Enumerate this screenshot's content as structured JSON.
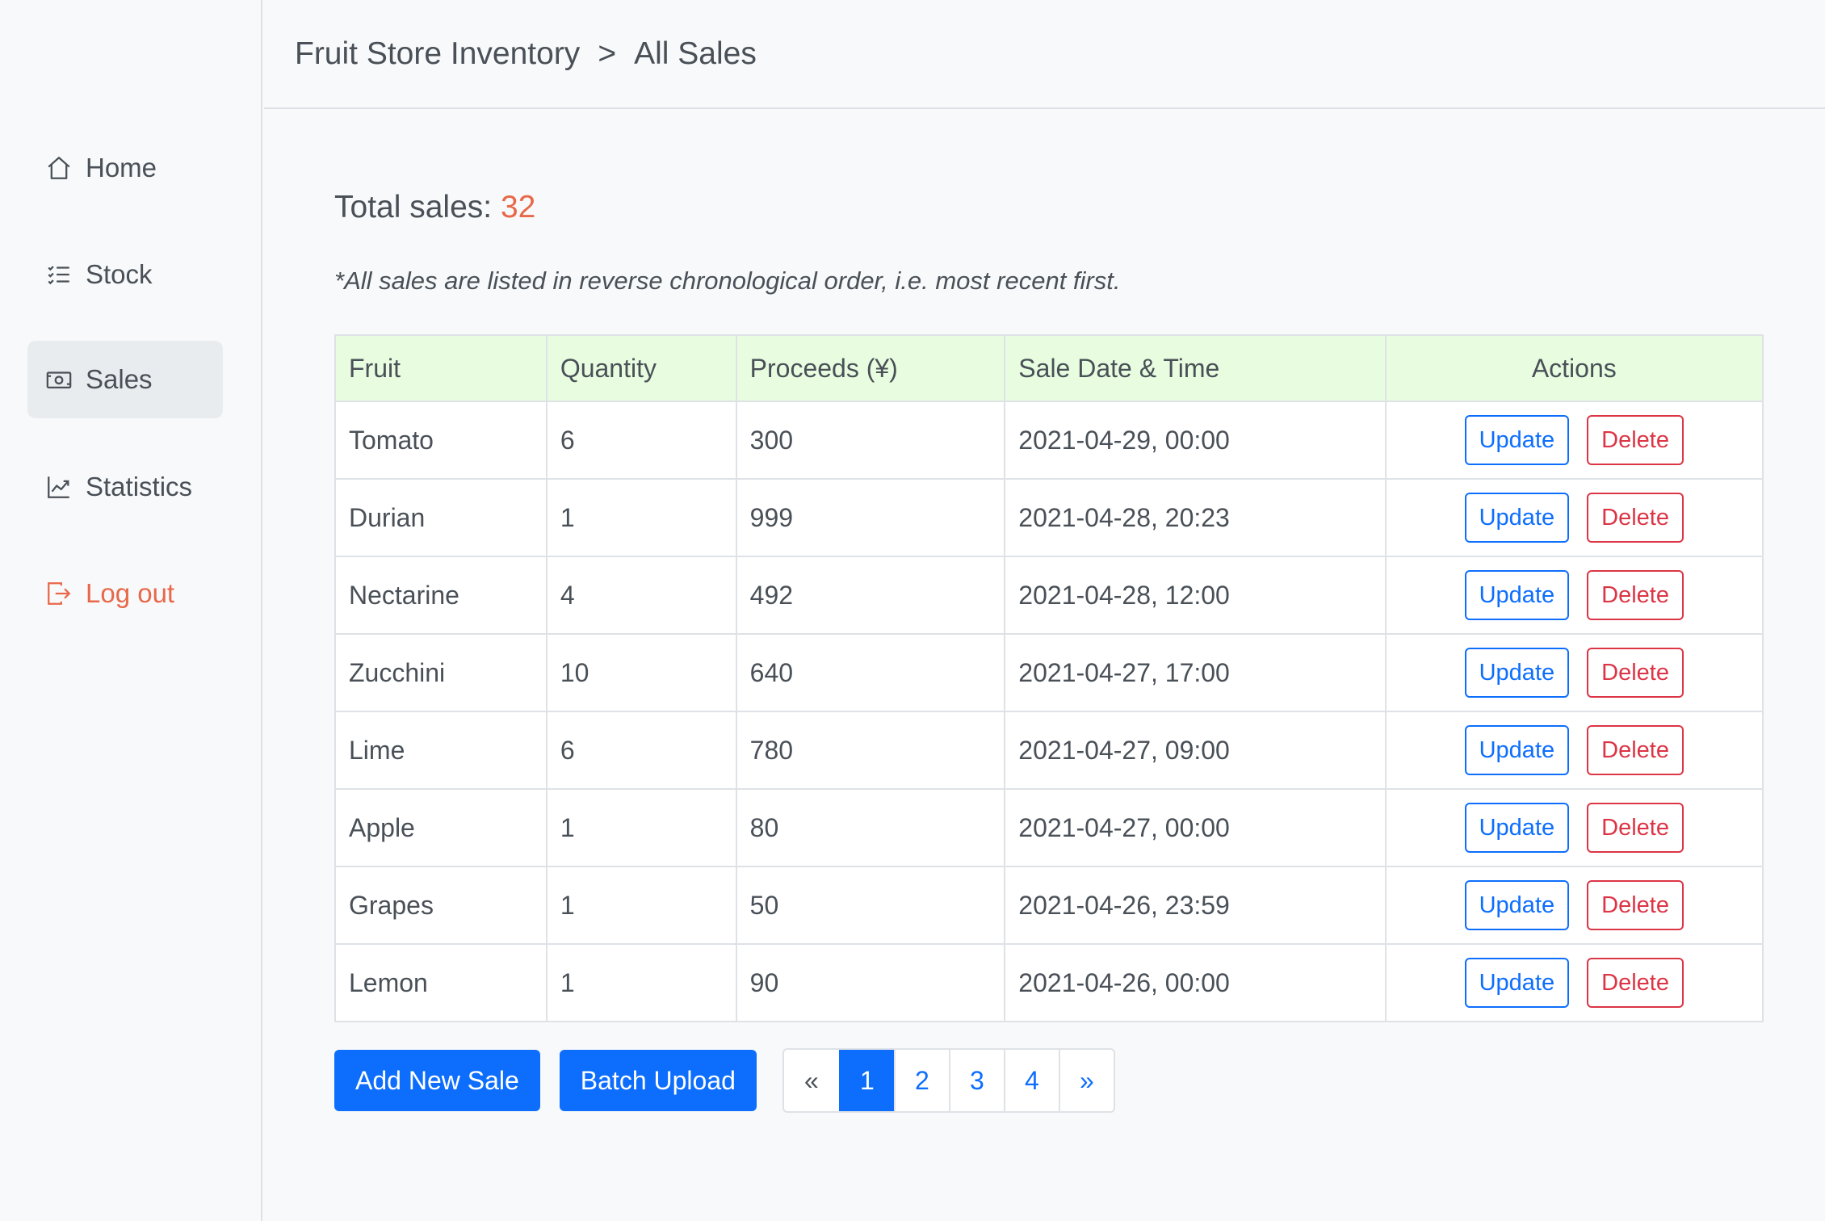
{
  "sidebar": {
    "items": [
      {
        "label": "Home",
        "icon": "house-icon"
      },
      {
        "label": "Stock",
        "icon": "list-icon"
      },
      {
        "label": "Sales",
        "icon": "cash-icon"
      },
      {
        "label": "Statistics",
        "icon": "graph-icon"
      },
      {
        "label": "Log out",
        "icon": "logout-icon"
      }
    ],
    "active": "Sales"
  },
  "header": {
    "breadcrumb_root": "Fruit Store Inventory",
    "breadcrumb_sep": ">",
    "breadcrumb_current": "All Sales"
  },
  "summary": {
    "total_label": "Total sales:",
    "total_count": "32",
    "note": "*All sales are listed in reverse chronological order, i.e. most recent first."
  },
  "table": {
    "columns": [
      "Fruit",
      "Quantity",
      "Proceeds (¥)",
      "Sale Date & Time",
      "Actions"
    ],
    "update_label": "Update",
    "delete_label": "Delete",
    "rows": [
      {
        "fruit": "Tomato",
        "quantity": "6",
        "proceeds": "300",
        "datetime": "2021-04-29, 00:00"
      },
      {
        "fruit": "Durian",
        "quantity": "1",
        "proceeds": "999",
        "datetime": "2021-04-28, 20:23"
      },
      {
        "fruit": "Nectarine",
        "quantity": "4",
        "proceeds": "492",
        "datetime": "2021-04-28, 12:00"
      },
      {
        "fruit": "Zucchini",
        "quantity": "10",
        "proceeds": "640",
        "datetime": "2021-04-27, 17:00"
      },
      {
        "fruit": "Lime",
        "quantity": "6",
        "proceeds": "780",
        "datetime": "2021-04-27, 09:00"
      },
      {
        "fruit": "Apple",
        "quantity": "1",
        "proceeds": "80",
        "datetime": "2021-04-27, 00:00"
      },
      {
        "fruit": "Grapes",
        "quantity": "1",
        "proceeds": "50",
        "datetime": "2021-04-26, 23:59"
      },
      {
        "fruit": "Lemon",
        "quantity": "1",
        "proceeds": "90",
        "datetime": "2021-04-26, 00:00"
      }
    ]
  },
  "actions": {
    "add_label": "Add New Sale",
    "batch_label": "Batch Upload"
  },
  "pagination": {
    "prev": "«",
    "pages": [
      "1",
      "2",
      "3",
      "4"
    ],
    "current": "1",
    "next": "»"
  },
  "colors": {
    "accent": "#0d6efd",
    "danger": "#dc3545",
    "highlight": "#e8684a",
    "table_header_bg": "#e8fde0"
  }
}
